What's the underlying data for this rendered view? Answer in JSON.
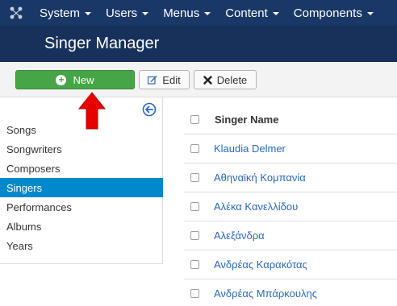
{
  "topnav": {
    "items": [
      {
        "label": "System"
      },
      {
        "label": "Users"
      },
      {
        "label": "Menus"
      },
      {
        "label": "Content"
      },
      {
        "label": "Components"
      }
    ]
  },
  "header": {
    "title": "Singer Manager"
  },
  "toolbar": {
    "new_label": "New",
    "edit_label": "Edit",
    "delete_label": "Delete"
  },
  "sidebar": {
    "items": [
      {
        "label": "Songs"
      },
      {
        "label": "Songwriters"
      },
      {
        "label": "Composers"
      },
      {
        "label": "Singers",
        "active": true
      },
      {
        "label": "Performances"
      },
      {
        "label": "Albums"
      },
      {
        "label": "Years"
      }
    ]
  },
  "table": {
    "column_header": "Singer Name",
    "rows": [
      {
        "name": "Klaudia Delmer"
      },
      {
        "name": "Αθηναϊκή Κομπανία"
      },
      {
        "name": "Αλέκα Κανελλίδου"
      },
      {
        "name": "Αλεξάνδρα"
      },
      {
        "name": "Ανδρέας Καρακότας"
      },
      {
        "name": "Ανδρέας Μπάρκουλης"
      }
    ]
  },
  "colors": {
    "nav_bg": "#1a3867",
    "header_bg": "#17315a",
    "new_button": "#46a546",
    "active_sidebar": "#0088cc",
    "link": "#2a69b8",
    "annotation_arrow": "#e60000"
  }
}
